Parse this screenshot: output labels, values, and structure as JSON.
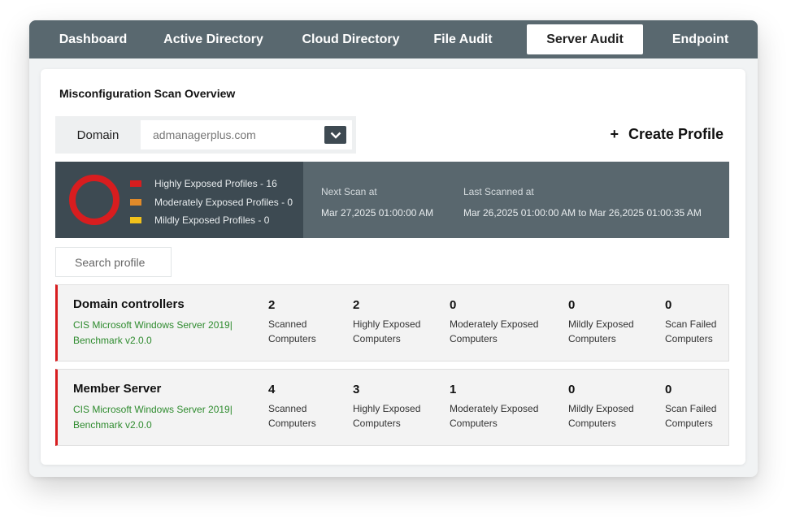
{
  "nav": {
    "tabs": [
      {
        "label": "Dashboard"
      },
      {
        "label": "Active Directory"
      },
      {
        "label": "Cloud Directory"
      },
      {
        "label": "File Audit"
      },
      {
        "label": "Server Audit"
      },
      {
        "label": "Endpoint"
      }
    ],
    "active": "Server Audit"
  },
  "overview": {
    "title": "Misconfiguration Scan Overview",
    "domain_label": "Domain",
    "domain_value": "admanagerplus.com",
    "create_profile": "Create Profile",
    "create_profile_icon": "plus-icon"
  },
  "summary": {
    "legend": [
      {
        "label": "Highly Exposed Profiles - 16",
        "color": "#d81d1f"
      },
      {
        "label": "Moderately Exposed Profiles - 0",
        "color": "#e08a2a"
      },
      {
        "label": "Mildly Exposed Profiles - 0",
        "color": "#f2c21b"
      }
    ],
    "donut_color": "#d81d1f",
    "next_scan_label": "Next Scan at",
    "next_scan_value": "Mar 27,2025 01:00:00 AM",
    "last_scanned_label": "Last Scanned at",
    "last_scanned_value": "Mar 26,2025 01:00:00 AM to Mar 26,2025 01:00:35 AM"
  },
  "search": {
    "placeholder": "Search profile"
  },
  "profiles": [
    {
      "name": "Domain controllers",
      "benchmark_line1": "CIS Microsoft Windows Server 2019|",
      "benchmark_line2": "Benchmark v2.0.0",
      "metrics": [
        {
          "value": "2",
          "label1": "Scanned",
          "label2": "Computers"
        },
        {
          "value": "2",
          "label1": "Highly Exposed",
          "label2": "Computers"
        },
        {
          "value": "0",
          "label1": "Moderately Exposed",
          "label2": "Computers"
        },
        {
          "value": "0",
          "label1": "Mildly Exposed",
          "label2": "Computers"
        },
        {
          "value": "0",
          "label1": "Scan Failed",
          "label2": "Computers"
        }
      ]
    },
    {
      "name": "Member Server",
      "benchmark_line1": "CIS Microsoft Windows Server 2019|",
      "benchmark_line2": "Benchmark v2.0.0",
      "metrics": [
        {
          "value": "4",
          "label1": "Scanned",
          "label2": "Computers"
        },
        {
          "value": "3",
          "label1": "Highly Exposed",
          "label2": "Computers"
        },
        {
          "value": "1",
          "label1": "Moderately Exposed",
          "label2": "Computers"
        },
        {
          "value": "0",
          "label1": "Mildly Exposed",
          "label2": "Computers"
        },
        {
          "value": "0",
          "label1": "Scan Failed",
          "label2": "Computers"
        }
      ]
    }
  ]
}
